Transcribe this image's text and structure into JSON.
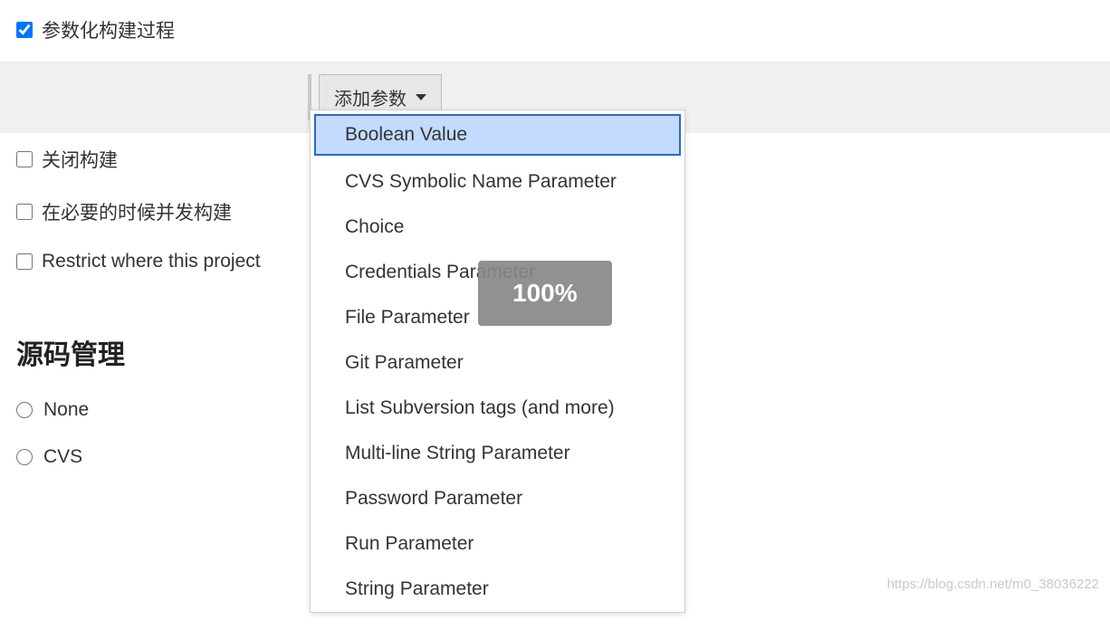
{
  "checkboxes": {
    "parametrized_build": {
      "label": "参数化构建过程",
      "checked": true
    },
    "disable_build": {
      "label": "关闭构建",
      "checked": false
    },
    "concurrent_build": {
      "label": "在必要的时候并发构建",
      "checked": false
    },
    "restrict_where": {
      "label": "Restrict where this project",
      "checked": false
    }
  },
  "add_param_button": "添加参数",
  "dropdown_items": [
    "Boolean Value",
    "CVS Symbolic Name Parameter",
    "Choice",
    "Credentials Parameter",
    "File Parameter",
    "Git Parameter",
    "List Subversion tags (and more)",
    "Multi-line String Parameter",
    "Password Parameter",
    "Run Parameter",
    "String Parameter"
  ],
  "scm_heading": "源码管理",
  "scm_radios": {
    "none": "None",
    "cvs": "CVS"
  },
  "zoom_overlay": "100%",
  "watermark": "https://blog.csdn.net/m0_38036222"
}
